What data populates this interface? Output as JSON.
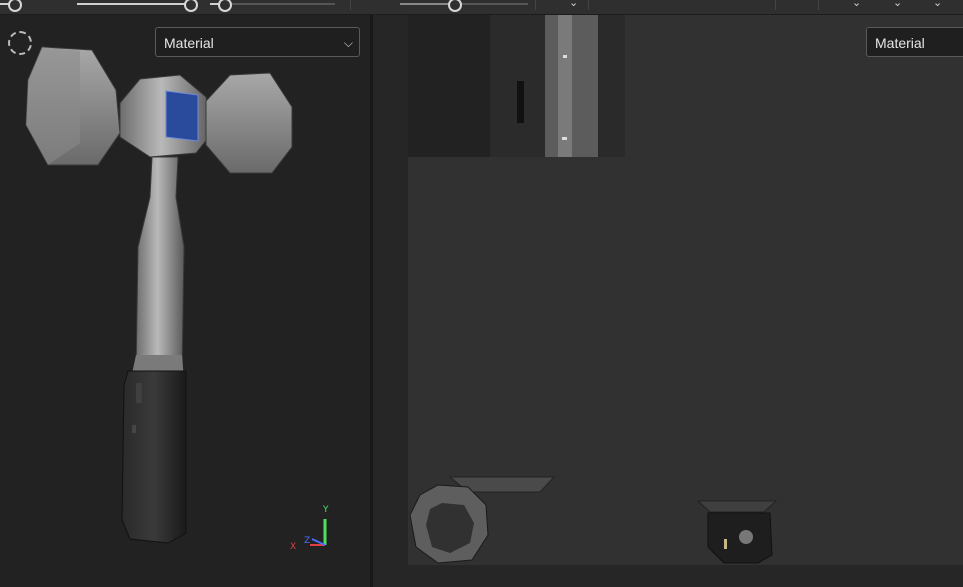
{
  "left_viewport": {
    "material_select": {
      "value": "Material"
    },
    "axes": {
      "x": "X",
      "y": "Y",
      "z": "Z"
    }
  },
  "right_viewport": {
    "material_select": {
      "value": "Material"
    }
  },
  "colors": {
    "panel_bg": "#222222",
    "uv_canvas_bg": "#313131",
    "axis_x": "#e04040",
    "axis_y": "#4ee05a",
    "axis_z": "#4a6cff",
    "selected_face": "#2a4a9c"
  },
  "icons": [
    "viewport-gizmo-icon",
    "chevron-down-icon"
  ]
}
